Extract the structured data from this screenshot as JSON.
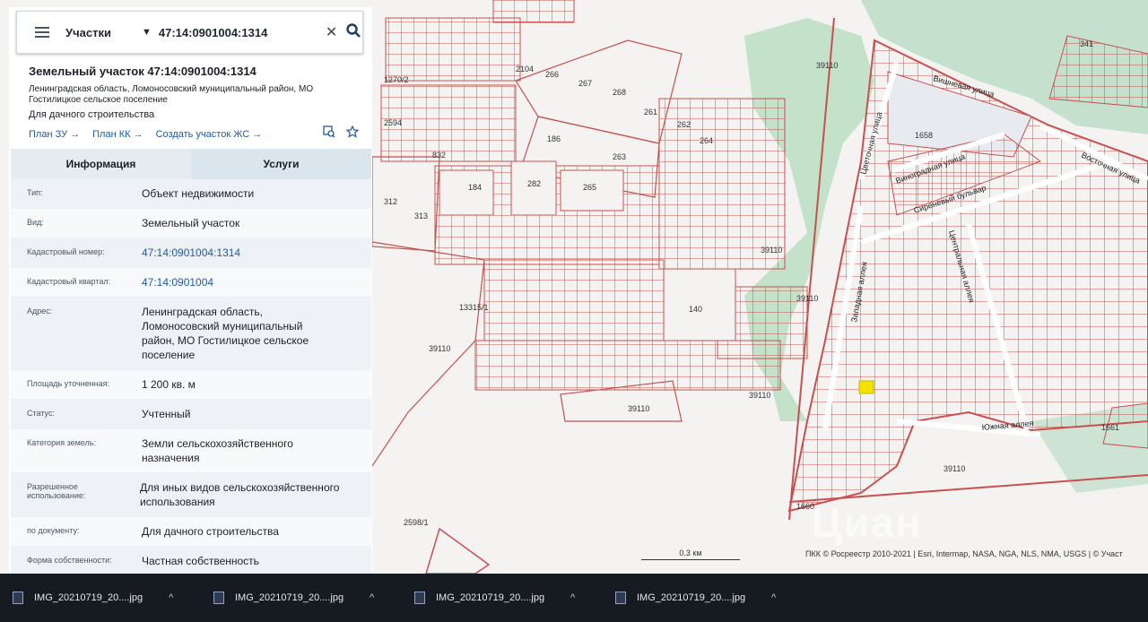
{
  "search": {
    "layer": "Участки",
    "query": "47:14:0901004:1314"
  },
  "parcel": {
    "title": "Земельный участок 47:14:0901004:1314",
    "address_short": "Ленинградская область, Ломоносовский муниципальный район, МО Гостилицкое сельское поселение",
    "purpose": "Для дачного строительства",
    "links": [
      "План ЗУ →",
      "План КК →",
      "Создать участок ЖС →"
    ]
  },
  "tabs": {
    "info": "Информация",
    "services": "Услуги"
  },
  "fields": [
    {
      "label": "Тип:",
      "value": "Объект недвижимости"
    },
    {
      "label": "Вид:",
      "value": "Земельный участок"
    },
    {
      "label": "Кадастровый номер:",
      "value": "47:14:0901004:1314"
    },
    {
      "label": "Кадастровый квартал:",
      "value": "47:14:0901004"
    },
    {
      "label": "Адрес:",
      "value": "Ленинградская область, Ломоносовский муниципальный район, МО Гостилицкое сельское поселение"
    },
    {
      "label": "Площадь уточненная:",
      "value": "1 200 кв. м"
    },
    {
      "label": "Статус:",
      "value": "Учтенный"
    },
    {
      "label": "Категория земель:",
      "value": "Земли сельскохозяйственного назначения"
    },
    {
      "label": "Разрешенное использование:",
      "value": "Для иных видов сельскохозяйственного использования"
    },
    {
      "label": "по документу:",
      "value": "Для дачного строительства"
    },
    {
      "label": "Форма собственности:",
      "value": "Частная собственность"
    }
  ],
  "map": {
    "labels": [
      "39110",
      "39110",
      "39110",
      "39110",
      "39110",
      "39110",
      "39110",
      "1658",
      "1661",
      "1660",
      "2104",
      "266",
      "267",
      "268",
      "261",
      "262",
      "264",
      "186",
      "263",
      "184",
      "282",
      "265",
      "312",
      "313",
      "140",
      "832",
      "2594",
      "1270/2",
      "13315/1",
      "2598/1",
      "341"
    ],
    "streets": [
      "Цветочная улица",
      "Виноградная улица",
      "Восточная улица",
      "Сиреневый бульвар",
      "Центральная аллея",
      "Западная аллея",
      "Южная аллея",
      "Вишневая улица"
    ],
    "scale": "0.3 км",
    "attribution": "ПКК © Росреестр 2010-2021 | Esri, Intermap, NASA, NGA, NLS, NMA, USGS | © Участ",
    "watermark": "Циан",
    "colors": {
      "parcel": "#c8504f",
      "forest": "#b8dcc0",
      "selected": "#f3e100"
    }
  },
  "downloads": [
    "IMG_20210719_20....jpg",
    "IMG_20210719_20....jpg",
    "IMG_20210719_20....jpg",
    "IMG_20210719_20....jpg"
  ]
}
